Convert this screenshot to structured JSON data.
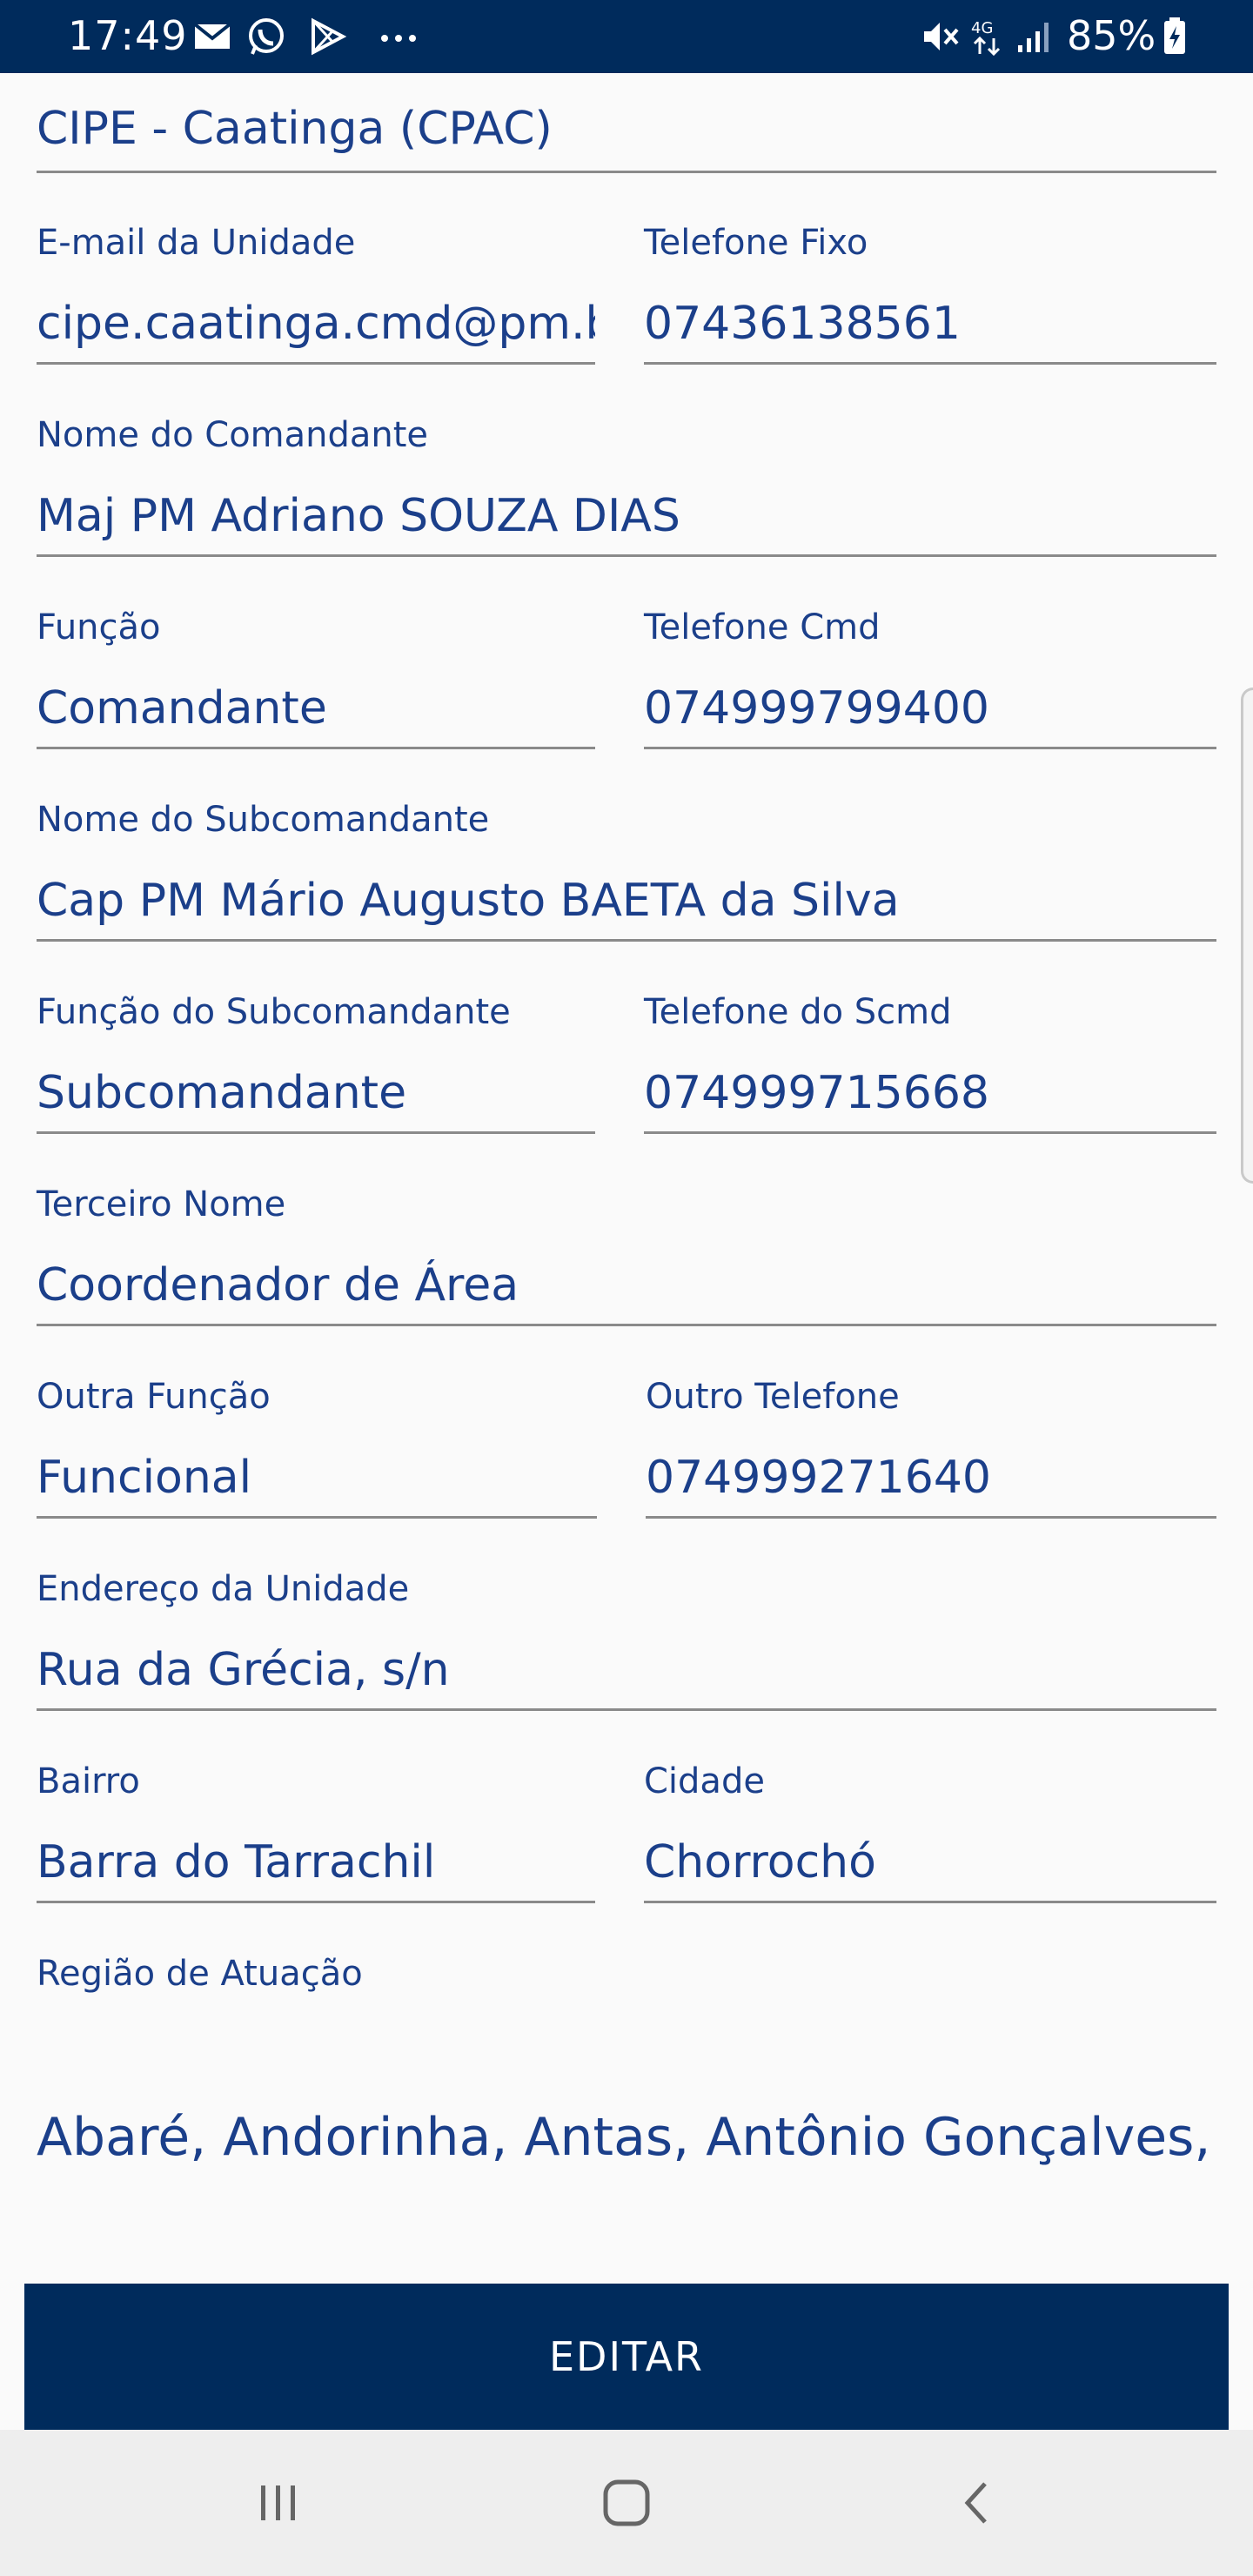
{
  "status_bar": {
    "time": "17:49",
    "battery": "85%",
    "network": "4G",
    "icons": [
      "mail-icon",
      "whatsapp-icon",
      "play-store-icon",
      "more-dots-icon",
      "mute-icon",
      "network-4g-icon",
      "signal-icon",
      "battery-charging-icon"
    ]
  },
  "form": {
    "unit_name": {
      "value": "CIPE - Caatinga (CPAC)"
    },
    "email": {
      "label": "E-mail da Unidade",
      "value": "cipe.caatinga.cmd@pm.ba."
    },
    "phone_fixed": {
      "label": "Telefone Fixo",
      "value": "07436138561"
    },
    "commander_name": {
      "label": "Nome do Comandante",
      "value": "Maj PM Adriano SOUZA DIAS"
    },
    "role": {
      "label": "Função",
      "value": "Comandante"
    },
    "commander_phone": {
      "label": "Telefone Cmd",
      "value": "074999799400"
    },
    "subcommander_name": {
      "label": "Nome do Subcomandante",
      "value": "Cap PM Mário Augusto BAETA da Silva"
    },
    "subcommander_role": {
      "label": "Função do Subcomandante",
      "value": "Subcomandante"
    },
    "subcommander_phone": {
      "label": "Telefone do Scmd",
      "value": "074999715668"
    },
    "third_name": {
      "label": "Terceiro Nome",
      "value": "Coordenador de Área"
    },
    "other_role": {
      "label": "Outra Função",
      "value": "Funcional"
    },
    "other_phone": {
      "label": "Outro Telefone",
      "value": "074999271640"
    },
    "address": {
      "label": "Endereço da Unidade",
      "value": "Rua da Grécia, s/n"
    },
    "neighborhood": {
      "label": "Bairro",
      "value": "Barra do Tarrachil"
    },
    "city": {
      "label": "Cidade",
      "value": "Chorrochó"
    },
    "region": {
      "label": "Região de Atuação",
      "value": "Abaré, Andorinha, Antas, Antônio Gonçalves, Ca"
    }
  },
  "edit_button": {
    "label": "EDITAR"
  },
  "nav_bar": {
    "icons": [
      "recent-apps-icon",
      "home-icon",
      "back-icon"
    ]
  },
  "colors": {
    "primary": "#002b5c",
    "text": "#1b3f8a",
    "underline": "#8a8a8a",
    "background": "#fafafa"
  }
}
